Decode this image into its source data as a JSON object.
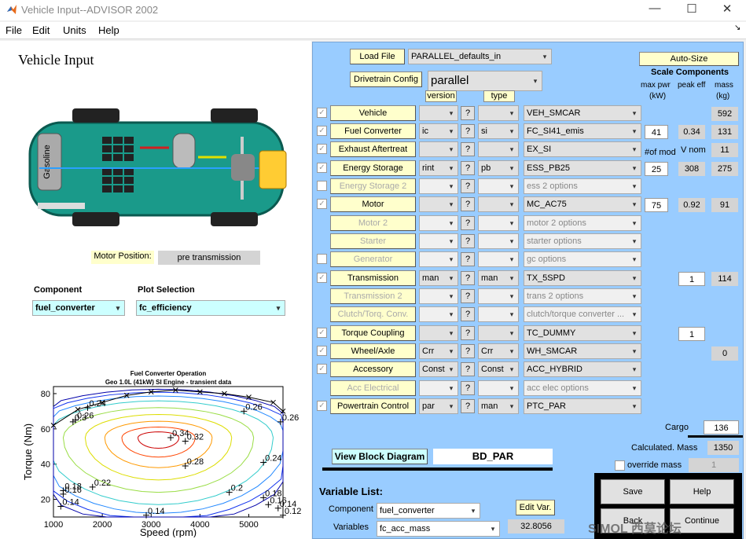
{
  "window": {
    "title": "Vehicle Input--ADVISOR 2002",
    "minimize": "—",
    "maximize": "☐",
    "close": "✕"
  },
  "menu": [
    "File",
    "Edit",
    "Units",
    "Help"
  ],
  "left": {
    "heading": "Vehicle Input",
    "fuel_label": "Gasoline",
    "motor_position_label": "Motor Position:",
    "motor_position_value": "pre transmission",
    "component_label": "Component",
    "component_value": "fuel_converter",
    "plot_label": "Plot Selection",
    "plot_value": "fc_efficiency"
  },
  "chart_data": {
    "type": "contour",
    "title": "Fuel Converter Operation",
    "subtitle": "Geo 1.0L (41kW) SI Engine - transient data",
    "xlabel": "Speed (rpm)",
    "ylabel": "Torque (Nm)",
    "xticks": [
      1000,
      2000,
      3000,
      4000,
      5000
    ],
    "yticks": [
      20,
      40,
      60,
      80
    ],
    "xlim": [
      1000,
      5700
    ],
    "ylim": [
      10,
      84
    ],
    "contour_labels": [
      {
        "text": "0.34",
        "x": 3400,
        "y": 55
      },
      {
        "text": "0.32",
        "x": 3700,
        "y": 53
      },
      {
        "text": "0.28",
        "x": 3700,
        "y": 39
      },
      {
        "text": "0.26",
        "x": 4900,
        "y": 70
      },
      {
        "text": "0.26",
        "x": 5650,
        "y": 64
      },
      {
        "text": "0.26",
        "x": 1450,
        "y": 65
      },
      {
        "text": "0.24",
        "x": 1700,
        "y": 72
      },
      {
        "text": "0.24",
        "x": 5300,
        "y": 41
      },
      {
        "text": "0.22",
        "x": 1800,
        "y": 27
      },
      {
        "text": "0.2",
        "x": 4600,
        "y": 24
      },
      {
        "text": "0.18",
        "x": 1200,
        "y": 25
      },
      {
        "text": "0.18",
        "x": 5300,
        "y": 21
      },
      {
        "text": "0.16",
        "x": 1200,
        "y": 23
      },
      {
        "text": "0.16",
        "x": 5400,
        "y": 17
      },
      {
        "text": "0.14",
        "x": 1150,
        "y": 16
      },
      {
        "text": "0.14",
        "x": 5600,
        "y": 15
      },
      {
        "text": "0.14",
        "x": 2900,
        "y": 11
      },
      {
        "text": "0.12",
        "x": 5700,
        "y": 11
      },
      {
        "text": "0.3",
        "x": 1400,
        "y": 64
      }
    ],
    "max_torque": {
      "x": [
        1000,
        1500,
        2000,
        2500,
        3000,
        3500,
        4000,
        4500,
        5000,
        5500,
        5700
      ],
      "y": [
        62,
        71,
        75,
        79,
        81,
        82,
        81,
        80,
        78,
        75,
        70
      ]
    },
    "contour_colors": [
      "#cc0000",
      "#ff4400",
      "#ff9900",
      "#dddd00",
      "#99dd44",
      "#33cccc",
      "#2288ff",
      "#1133ee",
      "#0000aa"
    ]
  },
  "right": {
    "load_file": "Load File",
    "load_file_value": "PARALLEL_defaults_in",
    "drivetrain": "Drivetrain Config",
    "drivetrain_value": "parallel",
    "version": "version",
    "type": "type",
    "auto_size": "Auto-Size",
    "scale_components": "Scale Components",
    "col_maxpwr": "max pwr",
    "col_maxpwr_unit": "(kW)",
    "col_peakeff": "peak eff",
    "col_mass": "mass",
    "col_mass_unit": "(kg)",
    "numofmod": "#of mod",
    "vnom": "V nom",
    "rows": [
      {
        "label": "Vehicle",
        "ver": "",
        "typ": "",
        "file": "VEH_SMCAR",
        "mass": "592"
      },
      {
        "label": "Fuel Converter",
        "ver": "ic",
        "typ": "si",
        "file": "FC_SI41_emis",
        "pwr": "41",
        "eff": "0.34",
        "mass": "131"
      },
      {
        "label": "Exhaust Aftertreat",
        "ver": "",
        "typ": "",
        "file": "EX_SI",
        "mass": "11"
      },
      {
        "label": "Energy Storage",
        "ver": "rint",
        "typ": "pb",
        "file": "ESS_PB25",
        "pwr": "25",
        "eff": "308",
        "mass": "275"
      },
      {
        "label": "Energy Storage 2",
        "ver": "",
        "typ": "",
        "file": "ess 2 options"
      },
      {
        "label": "Motor",
        "ver": "",
        "typ": "",
        "file": "MC_AC75",
        "pwr": "75",
        "eff": "0.92",
        "mass": "91"
      },
      {
        "label": "Motor 2",
        "ver": "",
        "typ": "",
        "file": "motor 2 options"
      },
      {
        "label": "Starter",
        "ver": "",
        "typ": "",
        "file": "starter options"
      },
      {
        "label": "Generator",
        "ver": "",
        "typ": "",
        "file": "gc options"
      },
      {
        "label": "Transmission",
        "ver": "man",
        "typ": "man",
        "file": "TX_5SPD",
        "eff": "1",
        "mass": "114"
      },
      {
        "label": "Transmission 2",
        "ver": "",
        "typ": "",
        "file": "trans 2 options"
      },
      {
        "label": "Clutch/Torq. Conv.",
        "ver": "",
        "typ": "",
        "file": "clutch/torque converter ..."
      },
      {
        "label": "Torque Coupling",
        "ver": "",
        "typ": "",
        "file": "TC_DUMMY",
        "eff": "1"
      },
      {
        "label": "Wheel/Axle",
        "ver": "Crr",
        "typ": "Crr",
        "file": "WH_SMCAR",
        "mass": "0"
      },
      {
        "label": "Accessory",
        "ver": "Const",
        "typ": "Const",
        "file": "ACC_HYBRID"
      },
      {
        "label": "Acc Electrical",
        "ver": "",
        "typ": "",
        "file": "acc elec options"
      },
      {
        "label": "Powertrain Control",
        "ver": "par",
        "typ": "man",
        "file": "PTC_PAR"
      }
    ],
    "q": "?",
    "cargo_label": "Cargo",
    "cargo_value": "136",
    "calc_mass_label": "Calculated. Mass",
    "calc_mass_value": "1350",
    "override_label": "override mass",
    "override_value": "1",
    "view_block": "View Block Diagram",
    "block_name": "BD_PAR",
    "var_list": "Variable List:",
    "var_component_label": "Component",
    "var_component_value": "fuel_converter",
    "edit_var": "Edit Var.",
    "variables_label": "Variables",
    "variables_value": "fc_acc_mass",
    "variables_readout": "32.8056",
    "save": "Save",
    "help": "Help",
    "back": "Back",
    "continue": "Continue",
    "watermark": "SIMOL 西莫论坛"
  }
}
